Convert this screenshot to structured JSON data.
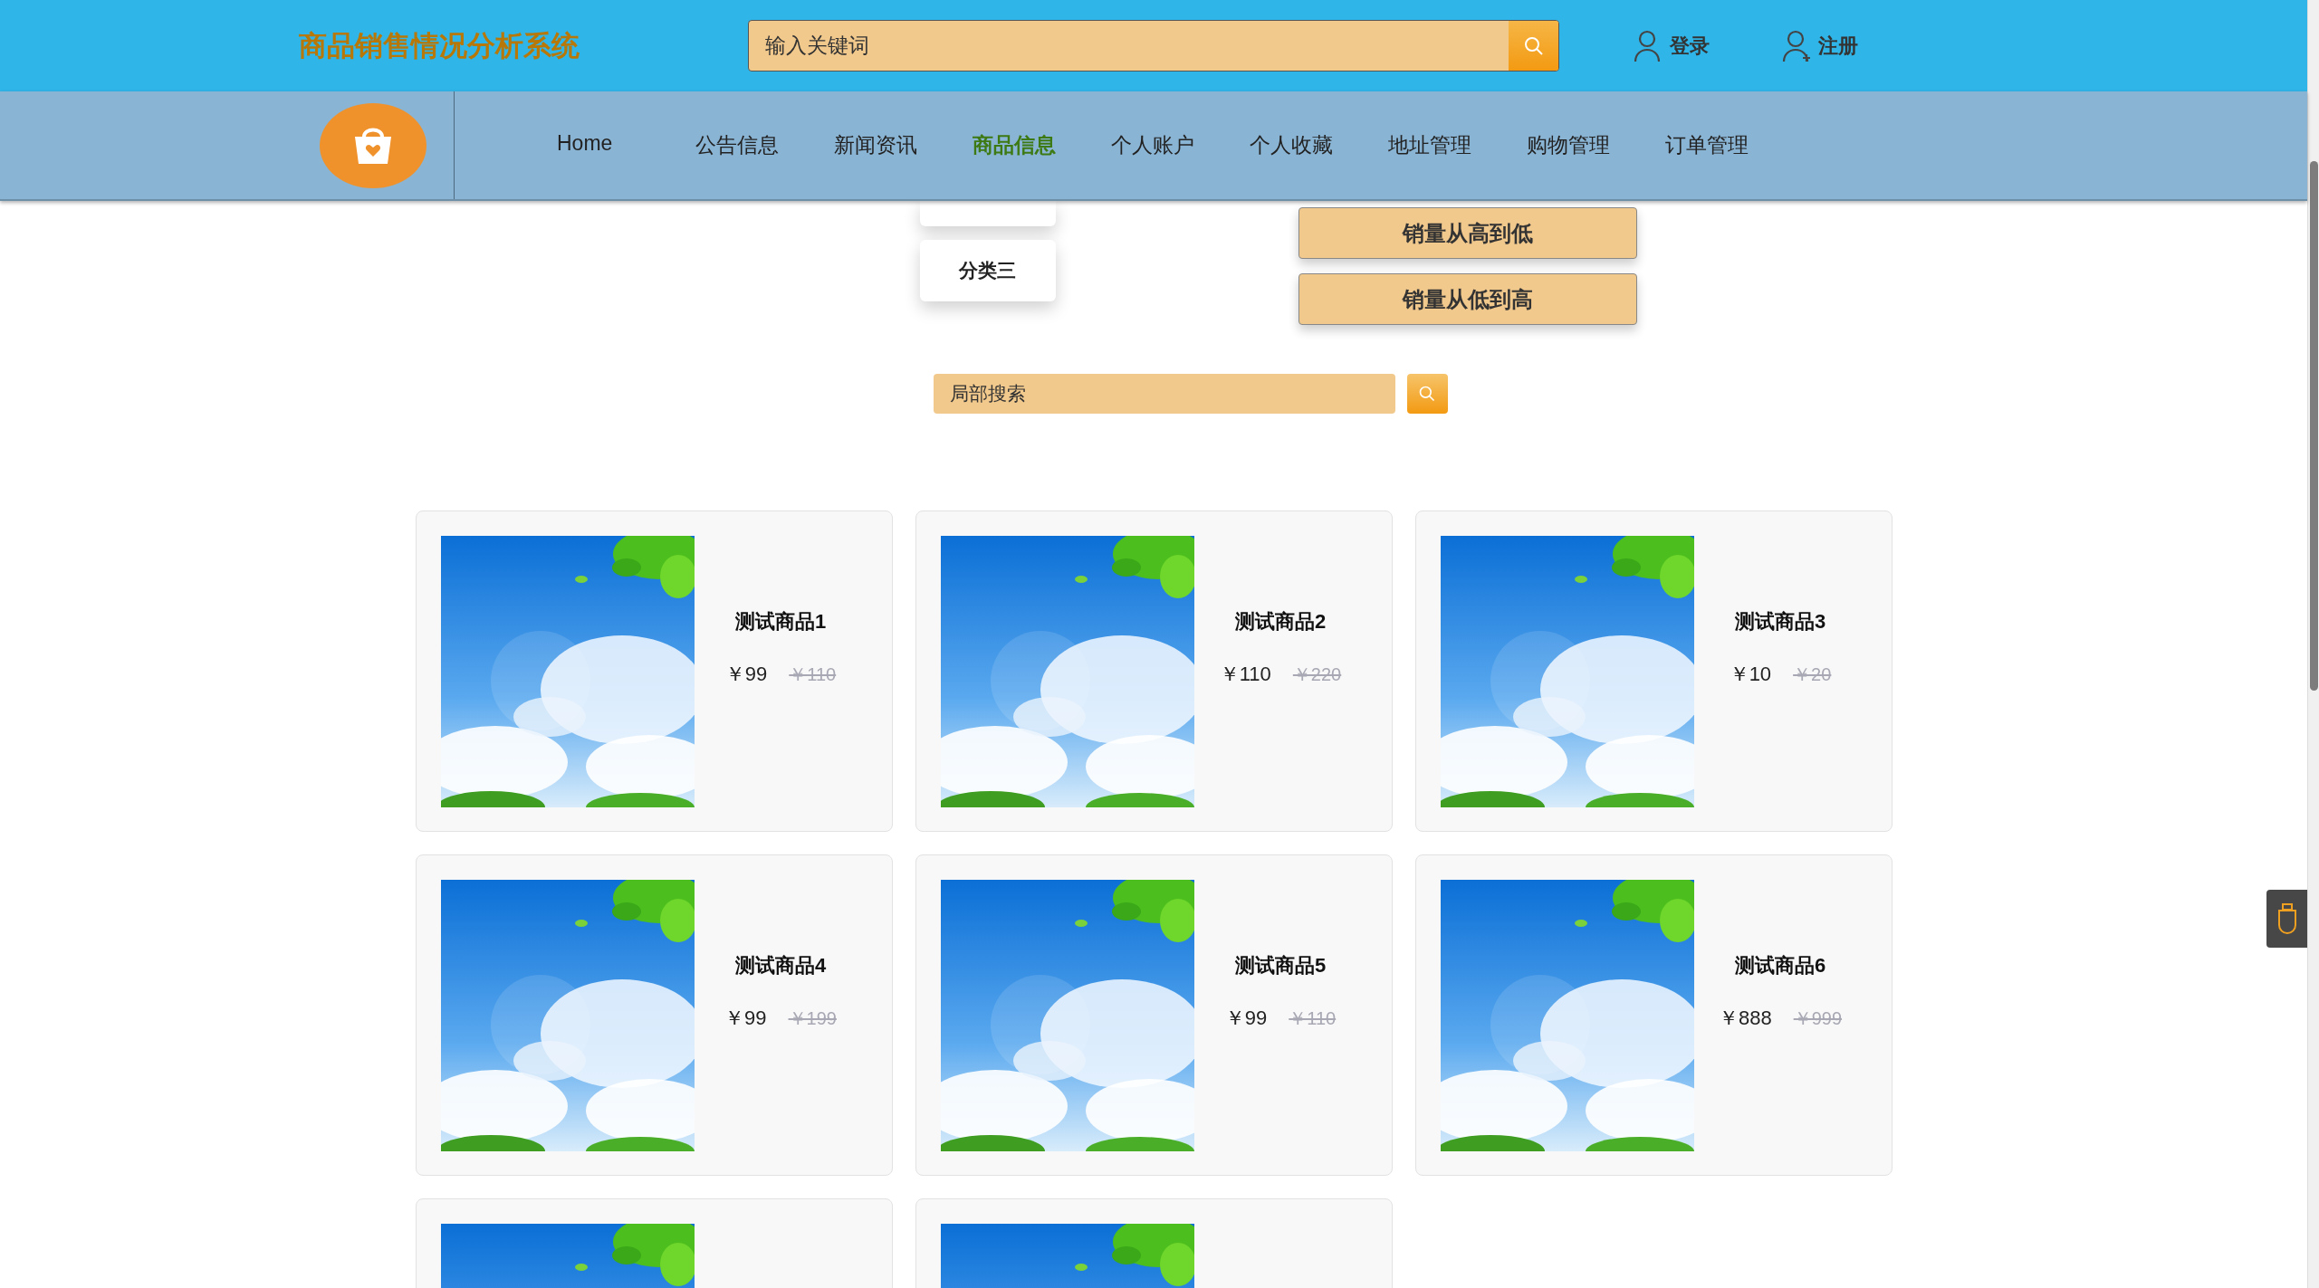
{
  "header": {
    "title": "商品销售情况分析系统",
    "search": {
      "placeholder": "输入关键词"
    },
    "user_links": [
      {
        "label": "登录",
        "kind": "login"
      },
      {
        "label": "注册",
        "kind": "register"
      }
    ]
  },
  "nav": {
    "items": [
      {
        "label": "Home",
        "selected": false
      },
      {
        "label": "公告信息",
        "selected": false
      },
      {
        "label": "新闻资讯",
        "selected": false
      },
      {
        "label": "商品信息",
        "selected": true
      },
      {
        "label": "个人账户",
        "selected": false
      },
      {
        "label": "个人收藏",
        "selected": false
      },
      {
        "label": "地址管理",
        "selected": false
      },
      {
        "label": "购物管理",
        "selected": false
      },
      {
        "label": "订单管理",
        "selected": false
      }
    ]
  },
  "category_menu": {
    "items": [
      {
        "kind": "clipped"
      },
      {
        "kind": "full",
        "label": "分类三"
      }
    ]
  },
  "sort_menu": {
    "items": [
      "销量从高到低",
      "销量从低到高"
    ]
  },
  "local_search": {
    "placeholder": "局部搜索"
  },
  "products": [
    {
      "kind": "full",
      "name": "测试商品1",
      "price": "￥99",
      "original_price": "￥110"
    },
    {
      "kind": "full",
      "name": "测试商品2",
      "price": "￥110",
      "original_price": "￥220"
    },
    {
      "kind": "full",
      "name": "测试商品3",
      "price": "￥10",
      "original_price": "￥20"
    },
    {
      "kind": "full",
      "name": "测试商品4",
      "price": "￥99",
      "original_price": "￥199"
    },
    {
      "kind": "full",
      "name": "测试商品5",
      "price": "￥99",
      "original_price": "￥110"
    },
    {
      "kind": "full",
      "name": "测试商品6",
      "price": "￥888",
      "original_price": "￥999"
    },
    {
      "kind": "cut"
    },
    {
      "kind": "cut"
    }
  ]
}
